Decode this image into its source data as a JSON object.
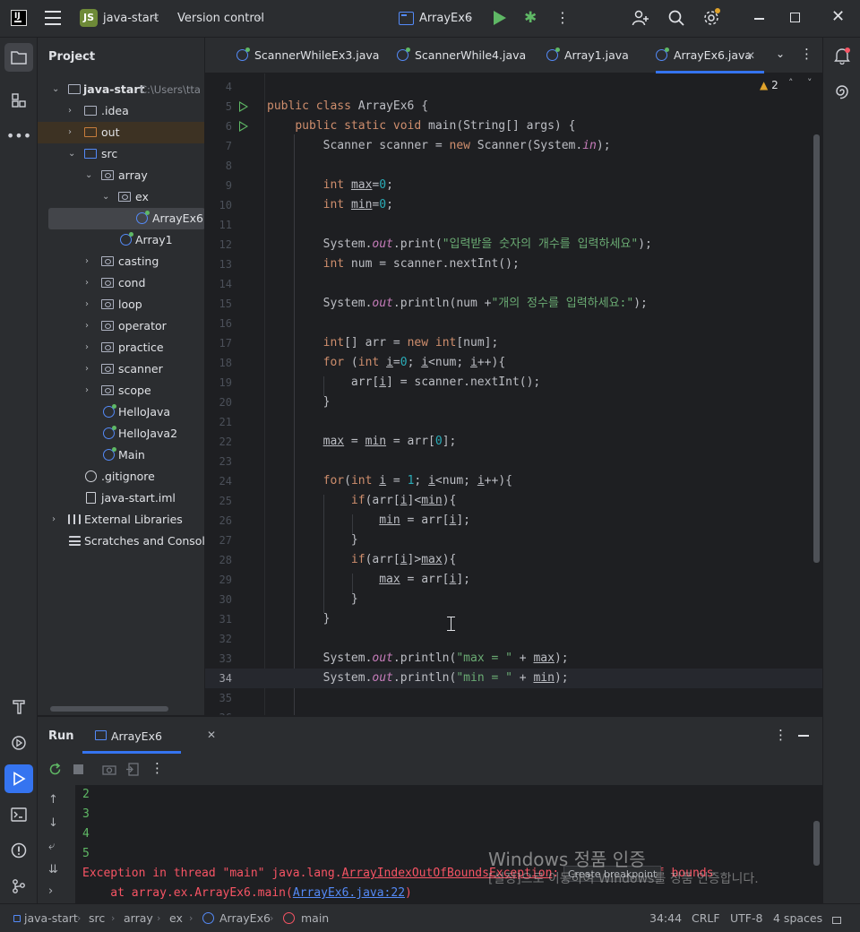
{
  "titlebar": {
    "project_badge": "JS",
    "project_name": "java-start",
    "version_control": "Version control",
    "run_config": "ArrayEx6"
  },
  "project_panel": {
    "title": "Project",
    "tree": [
      {
        "label": "java-start",
        "path": "C:\\Users\\tta"
      },
      {
        "label": ".idea"
      },
      {
        "label": "out"
      },
      {
        "label": "src"
      },
      {
        "label": "array"
      },
      {
        "label": "ex"
      },
      {
        "label": "ArrayEx6"
      },
      {
        "label": "Array1"
      },
      {
        "label": "casting"
      },
      {
        "label": "cond"
      },
      {
        "label": "loop"
      },
      {
        "label": "operator"
      },
      {
        "label": "practice"
      },
      {
        "label": "scanner"
      },
      {
        "label": "scope"
      },
      {
        "label": "HelloJava"
      },
      {
        "label": "HelloJava2"
      },
      {
        "label": "Main"
      },
      {
        "label": ".gitignore"
      },
      {
        "label": "java-start.iml"
      },
      {
        "label": "External Libraries"
      },
      {
        "label": "Scratches and Consoles"
      }
    ]
  },
  "editor_tabs": [
    {
      "label": "ScannerWhileEx3.java"
    },
    {
      "label": "ScannerWhile4.java"
    },
    {
      "label": "Array1.java"
    },
    {
      "label": "ArrayEx6.java"
    }
  ],
  "editor": {
    "warning_count": "2",
    "line_numbers": [
      "4",
      "5",
      "6",
      "7",
      "8",
      "9",
      "10",
      "11",
      "12",
      "13",
      "14",
      "15",
      "16",
      "17",
      "18",
      "19",
      "20",
      "21",
      "22",
      "23",
      "24",
      "25",
      "26",
      "27",
      "28",
      "29",
      "30",
      "31",
      "32",
      "33",
      "34",
      "35",
      "36"
    ]
  },
  "run_panel": {
    "title": "Run",
    "tab_label": "ArrayEx6",
    "output_lines": [
      "2",
      "3",
      "4",
      "5"
    ],
    "error_prefix": "Exception in thread \"main\" java.lang.",
    "error_class": "ArrayIndexOutOfBoundsException",
    "error_suffix": ": Index 5 out of bounds",
    "stack_prefix": "    at array.ex.ArrayEx6.main(",
    "stack_link": "ArrayEx6.java:22",
    "stack_suffix": ")",
    "breakpoint_tooltip": "Create breakpoint",
    "watermark_title": "Windows 정품 인증",
    "watermark_body": "[설정]으로 이동하여 Windows를 정품 인증합니다."
  },
  "statusbar": {
    "crumbs": [
      "java-start",
      "src",
      "array",
      "ex",
      "ArrayEx6",
      "main"
    ],
    "position": "34:44",
    "line_sep": "CRLF",
    "encoding": "UTF-8",
    "indent": "4 spaces"
  },
  "colors": {
    "accent": "#3574f0",
    "run_green": "#5fb865",
    "error_red": "#f75464",
    "keyword": "#cf8e6d",
    "string": "#6aab73",
    "number": "#2aacb8"
  }
}
